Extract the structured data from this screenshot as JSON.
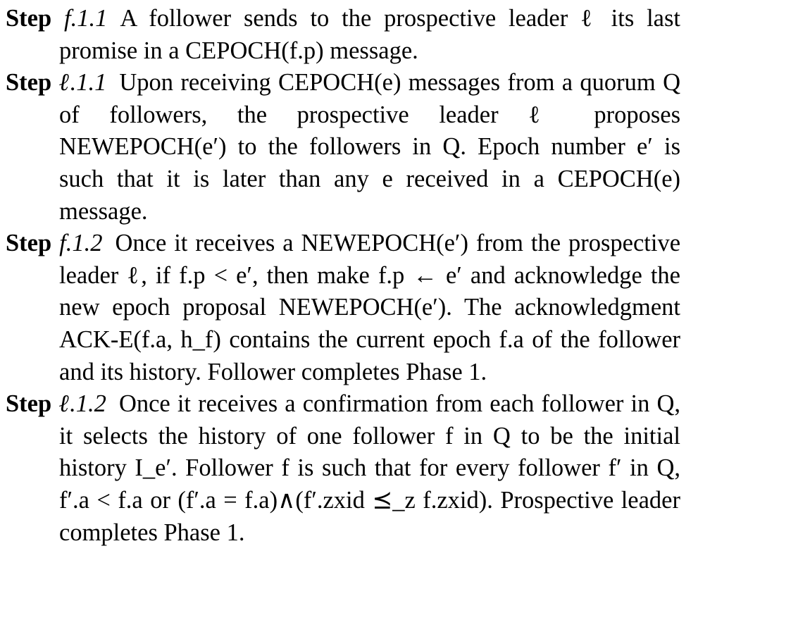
{
  "steps": [
    {
      "keyword": "Step",
      "number": "f.1.1",
      "body": "A follower sends to the prospective leader ℓ its last promise in a CEPOCH(f.p) message."
    },
    {
      "keyword": "Step",
      "number": "ℓ.1.1",
      "body": "Upon receiving CEPOCH(e) messages from a quorum Q of followers, the prospective leader ℓ proposes NEWEPOCH(e′) to the followers in Q. Epoch number e′ is such that it is later than any e received in a CEPOCH(e) message."
    },
    {
      "keyword": "Step",
      "number": "f.1.2",
      "body": "Once it receives a NEWEPOCH(e′) from the prospective leader ℓ, if f.p < e′, then make f.p ← e′ and acknowledge the new epoch proposal NEWEPOCH(e′). The acknowledgment ACK-E(f.a, h_f) contains the current epoch f.a of the follower and its history. Follower completes Phase 1."
    },
    {
      "keyword": "Step",
      "number": "ℓ.1.2",
      "body": "Once it receives a confirmation from each follower in Q, it selects the history of one follower f in Q to be the initial history I_e′. Follower f is such that for every follower f′ in Q, f′.a < f.a or (f′.a = f.a)∧(f′.zxid ⪯_z f.zxid). Prospective leader completes Phase 1."
    }
  ]
}
